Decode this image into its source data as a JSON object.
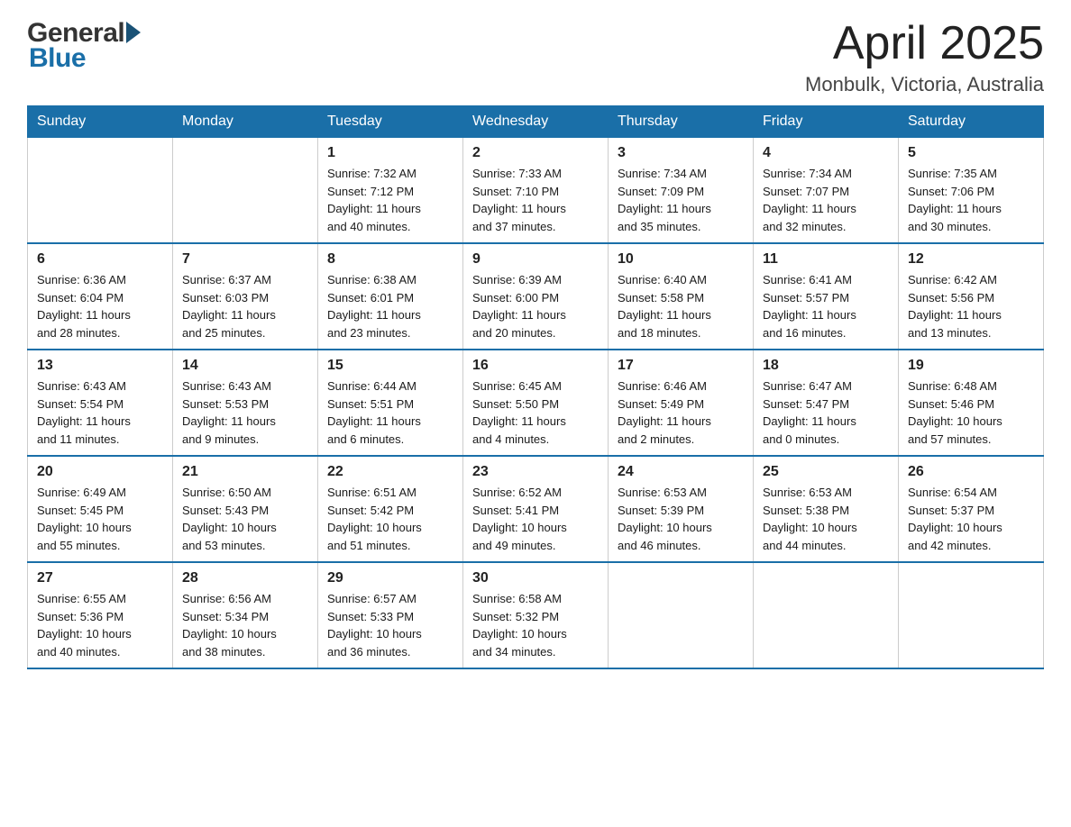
{
  "header": {
    "logo_general": "General",
    "logo_blue": "Blue",
    "month_title": "April 2025",
    "location": "Monbulk, Victoria, Australia"
  },
  "days_of_week": [
    "Sunday",
    "Monday",
    "Tuesday",
    "Wednesday",
    "Thursday",
    "Friday",
    "Saturday"
  ],
  "weeks": [
    [
      {
        "day": "",
        "info": ""
      },
      {
        "day": "",
        "info": ""
      },
      {
        "day": "1",
        "info": "Sunrise: 7:32 AM\nSunset: 7:12 PM\nDaylight: 11 hours\nand 40 minutes."
      },
      {
        "day": "2",
        "info": "Sunrise: 7:33 AM\nSunset: 7:10 PM\nDaylight: 11 hours\nand 37 minutes."
      },
      {
        "day": "3",
        "info": "Sunrise: 7:34 AM\nSunset: 7:09 PM\nDaylight: 11 hours\nand 35 minutes."
      },
      {
        "day": "4",
        "info": "Sunrise: 7:34 AM\nSunset: 7:07 PM\nDaylight: 11 hours\nand 32 minutes."
      },
      {
        "day": "5",
        "info": "Sunrise: 7:35 AM\nSunset: 7:06 PM\nDaylight: 11 hours\nand 30 minutes."
      }
    ],
    [
      {
        "day": "6",
        "info": "Sunrise: 6:36 AM\nSunset: 6:04 PM\nDaylight: 11 hours\nand 28 minutes."
      },
      {
        "day": "7",
        "info": "Sunrise: 6:37 AM\nSunset: 6:03 PM\nDaylight: 11 hours\nand 25 minutes."
      },
      {
        "day": "8",
        "info": "Sunrise: 6:38 AM\nSunset: 6:01 PM\nDaylight: 11 hours\nand 23 minutes."
      },
      {
        "day": "9",
        "info": "Sunrise: 6:39 AM\nSunset: 6:00 PM\nDaylight: 11 hours\nand 20 minutes."
      },
      {
        "day": "10",
        "info": "Sunrise: 6:40 AM\nSunset: 5:58 PM\nDaylight: 11 hours\nand 18 minutes."
      },
      {
        "day": "11",
        "info": "Sunrise: 6:41 AM\nSunset: 5:57 PM\nDaylight: 11 hours\nand 16 minutes."
      },
      {
        "day": "12",
        "info": "Sunrise: 6:42 AM\nSunset: 5:56 PM\nDaylight: 11 hours\nand 13 minutes."
      }
    ],
    [
      {
        "day": "13",
        "info": "Sunrise: 6:43 AM\nSunset: 5:54 PM\nDaylight: 11 hours\nand 11 minutes."
      },
      {
        "day": "14",
        "info": "Sunrise: 6:43 AM\nSunset: 5:53 PM\nDaylight: 11 hours\nand 9 minutes."
      },
      {
        "day": "15",
        "info": "Sunrise: 6:44 AM\nSunset: 5:51 PM\nDaylight: 11 hours\nand 6 minutes."
      },
      {
        "day": "16",
        "info": "Sunrise: 6:45 AM\nSunset: 5:50 PM\nDaylight: 11 hours\nand 4 minutes."
      },
      {
        "day": "17",
        "info": "Sunrise: 6:46 AM\nSunset: 5:49 PM\nDaylight: 11 hours\nand 2 minutes."
      },
      {
        "day": "18",
        "info": "Sunrise: 6:47 AM\nSunset: 5:47 PM\nDaylight: 11 hours\nand 0 minutes."
      },
      {
        "day": "19",
        "info": "Sunrise: 6:48 AM\nSunset: 5:46 PM\nDaylight: 10 hours\nand 57 minutes."
      }
    ],
    [
      {
        "day": "20",
        "info": "Sunrise: 6:49 AM\nSunset: 5:45 PM\nDaylight: 10 hours\nand 55 minutes."
      },
      {
        "day": "21",
        "info": "Sunrise: 6:50 AM\nSunset: 5:43 PM\nDaylight: 10 hours\nand 53 minutes."
      },
      {
        "day": "22",
        "info": "Sunrise: 6:51 AM\nSunset: 5:42 PM\nDaylight: 10 hours\nand 51 minutes."
      },
      {
        "day": "23",
        "info": "Sunrise: 6:52 AM\nSunset: 5:41 PM\nDaylight: 10 hours\nand 49 minutes."
      },
      {
        "day": "24",
        "info": "Sunrise: 6:53 AM\nSunset: 5:39 PM\nDaylight: 10 hours\nand 46 minutes."
      },
      {
        "day": "25",
        "info": "Sunrise: 6:53 AM\nSunset: 5:38 PM\nDaylight: 10 hours\nand 44 minutes."
      },
      {
        "day": "26",
        "info": "Sunrise: 6:54 AM\nSunset: 5:37 PM\nDaylight: 10 hours\nand 42 minutes."
      }
    ],
    [
      {
        "day": "27",
        "info": "Sunrise: 6:55 AM\nSunset: 5:36 PM\nDaylight: 10 hours\nand 40 minutes."
      },
      {
        "day": "28",
        "info": "Sunrise: 6:56 AM\nSunset: 5:34 PM\nDaylight: 10 hours\nand 38 minutes."
      },
      {
        "day": "29",
        "info": "Sunrise: 6:57 AM\nSunset: 5:33 PM\nDaylight: 10 hours\nand 36 minutes."
      },
      {
        "day": "30",
        "info": "Sunrise: 6:58 AM\nSunset: 5:32 PM\nDaylight: 10 hours\nand 34 minutes."
      },
      {
        "day": "",
        "info": ""
      },
      {
        "day": "",
        "info": ""
      },
      {
        "day": "",
        "info": ""
      }
    ]
  ]
}
